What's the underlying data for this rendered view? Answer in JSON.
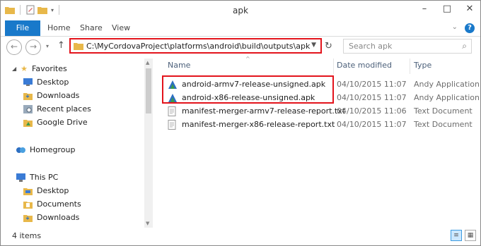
{
  "window": {
    "title": "apk"
  },
  "ribbon": {
    "tabs": [
      "File",
      "Home",
      "Share",
      "View"
    ]
  },
  "address": {
    "path": "C:\\MyCordovaProject\\platforms\\android\\build\\outputs\\apk",
    "search_placeholder": "Search apk"
  },
  "nav": {
    "favorites_label": "Favorites",
    "favorites": [
      "Desktop",
      "Downloads",
      "Recent places",
      "Google Drive"
    ],
    "homegroup_label": "Homegroup",
    "thispc_label": "This PC",
    "thispc": [
      "Desktop",
      "Documents",
      "Downloads"
    ]
  },
  "columns": {
    "name": "Name",
    "date": "Date modified",
    "type": "Type"
  },
  "files": [
    {
      "name": "android-armv7-release-unsigned.apk",
      "date": "04/10/2015 11:07",
      "type": "Andy Application",
      "icon": "apk-icon"
    },
    {
      "name": "android-x86-release-unsigned.apk",
      "date": "04/10/2015 11:07",
      "type": "Andy Application",
      "icon": "apk-icon"
    },
    {
      "name": "manifest-merger-armv7-release-report.txt",
      "date": "04/10/2015 11:06",
      "type": "Text Document",
      "icon": "text-file-icon"
    },
    {
      "name": "manifest-merger-x86-release-report.txt",
      "date": "04/10/2015 11:07",
      "type": "Text Document",
      "icon": "text-file-icon"
    }
  ],
  "status": {
    "item_count": "4 items"
  },
  "colors": {
    "accent": "#1979ca",
    "highlight": "#e3141c",
    "folder": "#e8b84a"
  }
}
